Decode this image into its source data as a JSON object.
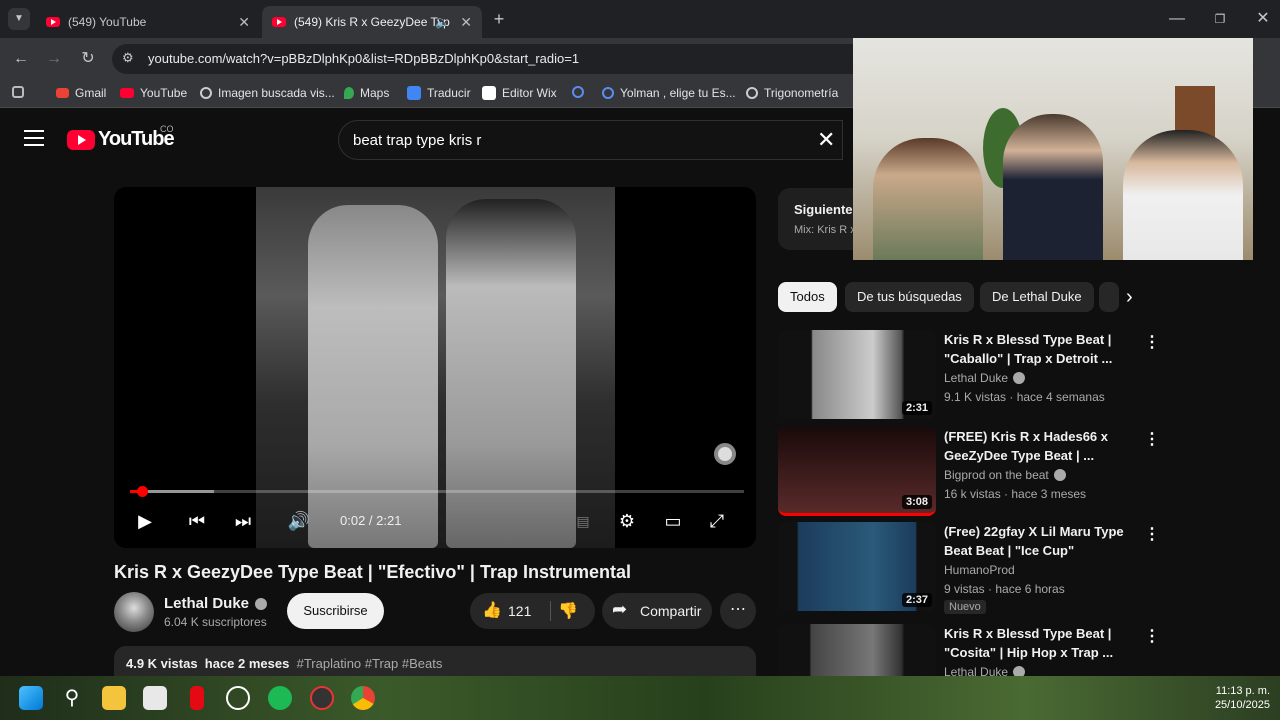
{
  "browser": {
    "tabs": [
      {
        "title": "(549) YouTube"
      },
      {
        "title": "(549) Kris R x GeezyDee Typ"
      }
    ],
    "url": "youtube.com/watch?v=pBBzDlphKp0&list=RDpBBzDlphKp0&start_radio=1",
    "bookmarks": [
      {
        "label": "Gmail"
      },
      {
        "label": "YouTube"
      },
      {
        "label": "Imagen buscada vis..."
      },
      {
        "label": "Maps"
      },
      {
        "label": "Traducir"
      },
      {
        "label": "Editor Wix"
      },
      {
        "label": "Yolman , elige tu Es..."
      },
      {
        "label": "Trigonometría"
      }
    ]
  },
  "masthead": {
    "logo_text": "YouTube",
    "region": "CO",
    "search_value": "beat trap type kris r"
  },
  "player": {
    "time": "0:02 / 2:21",
    "progress_fraction": 0.014
  },
  "video": {
    "title": "Kris R x GeezyDee Type Beat | \"Efectivo\" | Trap Instrumental",
    "channel": "Lethal Duke",
    "subscribers": "6.04 K suscriptores",
    "subscribe_label": "Suscribirse",
    "likes": "121",
    "share_label": "Compartir",
    "views": "4.9 K vistas",
    "age": "hace 2 meses",
    "tags": "#Traplatino #Trap #Beats"
  },
  "up_next": {
    "label": "Siguiente:",
    "sub": "Mix: Kris R x"
  },
  "chips": [
    "Todos",
    "De tus búsquedas",
    "De Lethal Duke"
  ],
  "recommendations": [
    {
      "title": "Kris R x Blessd Type Beat | \"Caballo\" | Trap x Detroit ...",
      "channel": "Lethal Duke",
      "meta": "9.1 K vistas · hace 4 semanas",
      "duration": "2:31",
      "badge": ""
    },
    {
      "title": "(FREE) Kris R x Hades66 x GeeZyDee Type Beat | ...",
      "channel": "Bigprod on the beat",
      "meta": "16 k vistas · hace 3 meses",
      "duration": "3:08",
      "badge": ""
    },
    {
      "title": "(Free) 22gfay X Lil Maru Type Beat Beat | \"Ice Cup\"",
      "channel": "HumanoProd",
      "meta": "9 vistas · hace 6 horas",
      "duration": "2:37",
      "badge": "Nuevo"
    },
    {
      "title": "Kris R x Blessd Type Beat | \"Cosita\" | Hip Hop x Trap ...",
      "channel": "Lethal Duke",
      "meta": "",
      "duration": "",
      "badge": ""
    }
  ],
  "taskbar": {
    "time": "11:13 p. m.",
    "date": "25/10/2025"
  },
  "colors": {
    "accent_red": "#ff0033",
    "background": "#0f0f0f"
  }
}
